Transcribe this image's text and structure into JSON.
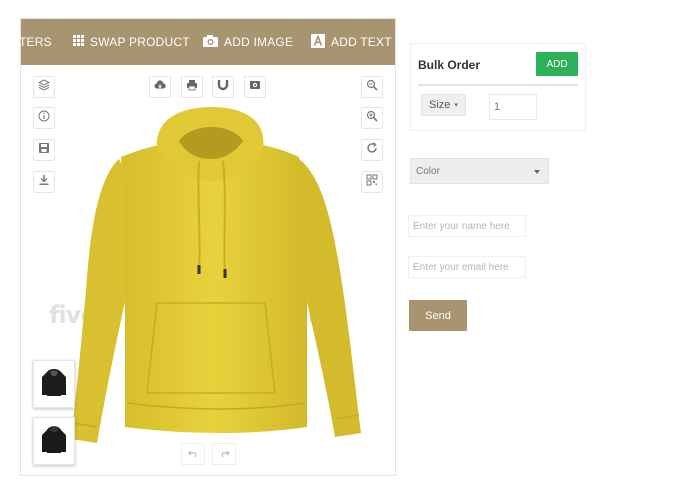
{
  "toolbar": {
    "filters_label": "TERS",
    "swap_label": "SWAP PRODUCT",
    "image_label": "ADD IMAGE",
    "text_label": "ADD TEXT"
  },
  "icons": {
    "left_tools": [
      "layers-icon",
      "info-icon",
      "save-icon",
      "download-icon"
    ],
    "top_tools": [
      "cloud-icon",
      "print-icon",
      "magnet-icon",
      "preview-icon"
    ],
    "right_tools": [
      "zoom-out-icon",
      "zoom-in-icon",
      "refresh-icon",
      "qr-icon"
    ],
    "history": [
      "undo-icon",
      "redo-icon"
    ]
  },
  "canvas": {
    "product": "hoodie",
    "product_color": "#e3cc36",
    "watermark": "fiverr."
  },
  "thumbnails": [
    "hoodie-front-thumbnail",
    "hoodie-back-thumbnail"
  ],
  "bulk_order": {
    "title": "Bulk Order",
    "add_label": "ADD",
    "size_label": "Size",
    "quantity": "1"
  },
  "color_select": {
    "selected": "Color"
  },
  "form": {
    "name_placeholder": "Enter your name here",
    "email_placeholder": "Enter your email here",
    "send_label": "Send"
  },
  "colors": {
    "accent": "#a99471",
    "add_button": "#2db158",
    "hoodie": "#e3cc36"
  }
}
